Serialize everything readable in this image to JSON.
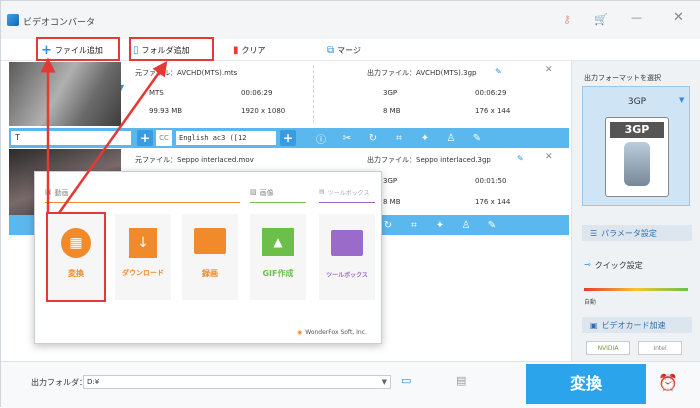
{
  "app": {
    "title": "ビデオコンバータ"
  },
  "toolbar": {
    "add_file": "ファイル追加",
    "add_folder": "フォルダ追加",
    "clear": "クリア",
    "merge": "マージ"
  },
  "items": [
    {
      "src_label": "元ファイル：AVCHD(MTS).mts",
      "out_label": "出力ファイル：AVCHD(MTS).3gp",
      "src_format": "MTS",
      "src_duration": "00:06:29",
      "src_size": "99.93 MB",
      "src_res": "1920 x 1080",
      "out_format": "3GP",
      "out_duration": "00:06:29",
      "out_size": "8 MB",
      "out_res": "176 x 144",
      "audio": "English ac3 ([12"
    },
    {
      "src_label": "元ファイル：Seppo interlaced.mov",
      "out_label": "出力ファイル：Seppo interlaced.3gp",
      "out_format": "3GP",
      "out_duration": "00:01:50",
      "out_size": "8 MB",
      "out_res": "176 x 144"
    }
  ],
  "side": {
    "title": "出力フォーマットを選択",
    "format": "3GP",
    "param": "パラメータ設定",
    "quick": "クイック設定",
    "auto": "自動",
    "hw": "ビデオカード加速",
    "nvidia": "NVIDIA",
    "intel": "Intel"
  },
  "bottom": {
    "folder_label": "出力フォルダ：",
    "folder_value": "D:¥",
    "convert": "変換"
  },
  "popup": {
    "sec_video": "動画",
    "sec_image": "画像",
    "sec_toolbox": "ツールボックス",
    "cards": [
      "変換",
      "ダウンロード",
      "録画",
      "GIF作成",
      "ツールボックス"
    ],
    "brand": "WonderFox Soft, Inc."
  },
  "colors": {
    "accent": "#3aa4e8",
    "arrow": "#e53935",
    "orange": "#f08a2b",
    "green": "#6cc04a",
    "purple": "#9b6bc9"
  }
}
